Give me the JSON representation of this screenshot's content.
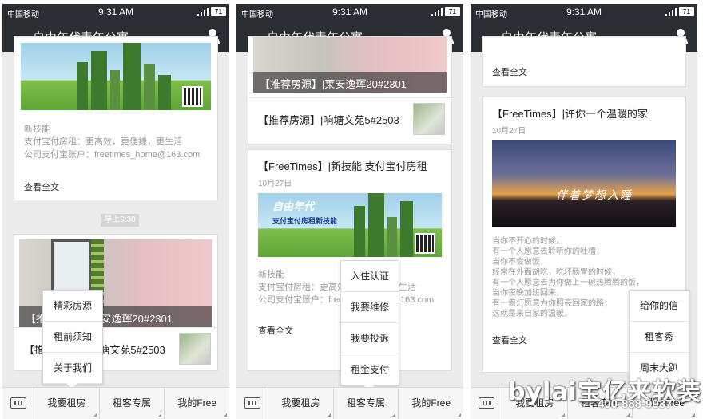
{
  "status": {
    "carrier": "中国移动",
    "time": "9:31 AM",
    "battery": "71",
    "network": "4G"
  },
  "nav": {
    "title": "自由年代青年公寓"
  },
  "screen1": {
    "desc_lines": [
      "新技能",
      "支付宝付房租：更高效，更便捷，更生活",
      "公司支付宝账户：freetimes_home@163.com"
    ],
    "read_all": "查看全文",
    "timestamp": "早上9:30",
    "overlay_title": "【推荐房源】|莱安逸珲20#2301",
    "sub_item_title": "【推荐房源】|响塘文苑5#2503",
    "popup": [
      "精彩房源",
      "租前须知",
      "关于我们"
    ]
  },
  "screen2": {
    "overlay_title": "【推荐房源】|莱安逸珲20#2301",
    "sub_item_title": "【推荐房源】|响塘文苑5#2503",
    "article_title": "【FreeTimes】|新技能 支付宝付房租",
    "article_date": "10月27日",
    "banner_brand": "自由年代",
    "banner_caption": "支付宝付房租新技能",
    "desc_lines": [
      "新技能",
      "支付宝付房租：更高效，更便捷，更生活",
      "公司支付宝账户：freetimes_home@163.com"
    ],
    "read_all": "查看全文",
    "popup": [
      "入住认证",
      "我要维修",
      "我要投诉",
      "租金支付"
    ]
  },
  "screen3": {
    "read_all_top": "查看全文",
    "article_title": "【FreeTimes】|许你一个温暖的家",
    "article_date": "10月27日",
    "image_text": "伴着梦想入睡",
    "desc_lines": [
      "当你不开心的时候，",
      "有一个人愿意去聆听你的吐槽；",
      "当你不会做饭，",
      "经常在外面胡吃，吃坏肠胃的时候，",
      "有一个人愿意去为你做上一碗热腾腾的饭，",
      "当你夜晚加班回来，",
      "有一盏灯愿意为你照亮回家的路；",
      "这就是来自家的温暖。"
    ],
    "read_all": "查看全文",
    "popup": [
      "给你的信",
      "租客秀",
      "周末大趴"
    ]
  },
  "tabbar": {
    "tabs": [
      "我要租房",
      "租客专属",
      "我的Free"
    ]
  },
  "watermark": {
    "line1": "bylai宝亿来软装",
    "line2": "400-888-9937"
  },
  "colors": {
    "navbar": "#2a2e33",
    "background": "#ebebeb",
    "card": "#ffffff",
    "muted_text": "#9a9a9a"
  }
}
